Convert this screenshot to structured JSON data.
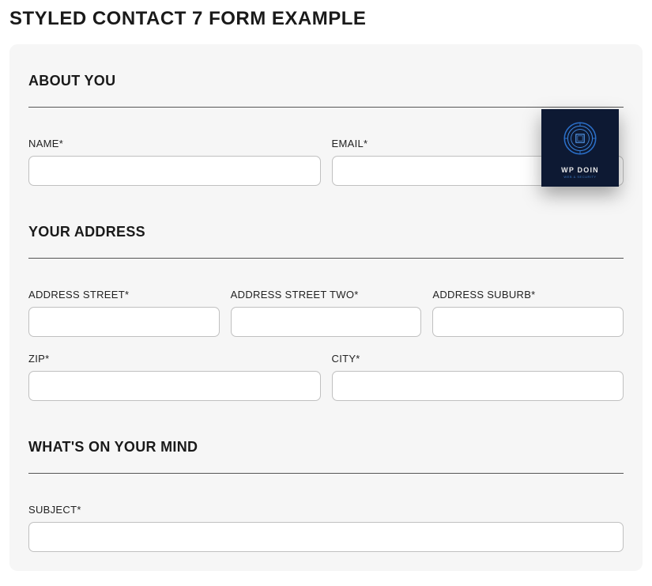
{
  "page": {
    "title": "STYLED CONTACT 7 FORM EXAMPLE"
  },
  "sections": {
    "about": {
      "heading": "ABOUT YOU",
      "name_label": "NAME*",
      "email_label": "EMAIL*"
    },
    "address": {
      "heading": "YOUR ADDRESS",
      "street_label": "ADDRESS STREET*",
      "street_two_label": "ADDRESS STREET TWO*",
      "suburb_label": "ADDRESS SUBURB*",
      "zip_label": "ZIP*",
      "city_label": "CITY*"
    },
    "mind": {
      "heading": "WHAT'S ON YOUR MIND",
      "subject_label": "SUBJECT*"
    }
  },
  "logo": {
    "text": "WP DOIN",
    "subtext": "WEB & SECURITY"
  }
}
